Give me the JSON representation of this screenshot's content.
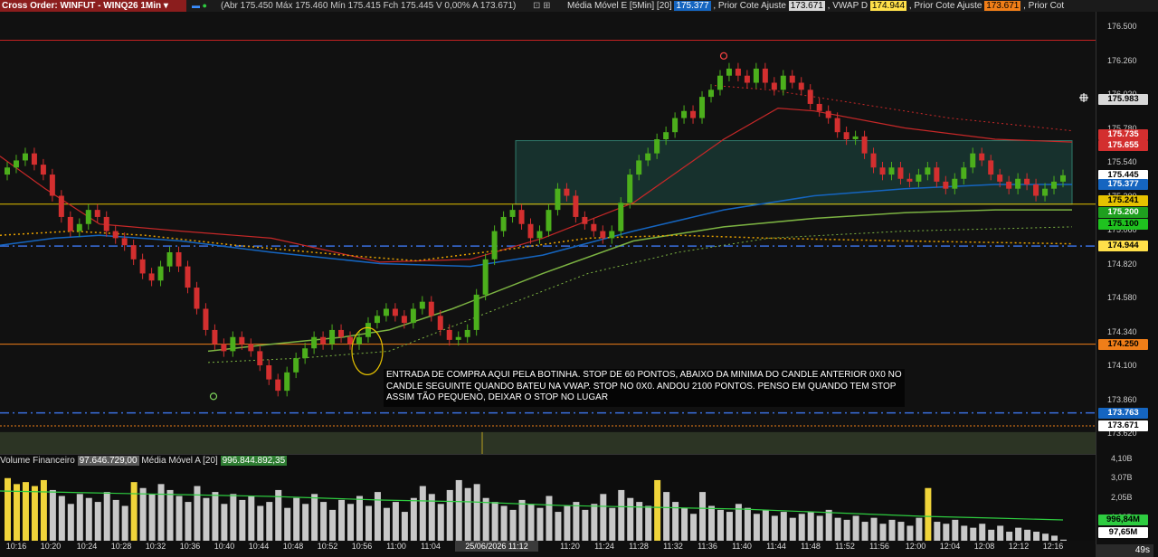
{
  "topbar": {
    "title": "Cross Order: WINFUT - WINQ26 1Min",
    "ohlc": "(Abr 175.450 Máx 175.460 Mín 175.415 Fch 175.445 V 0,00% A 173.671)",
    "ma_label": "Média Móvel E [5Min] [20]",
    "ma_value": "175.377",
    "prior1_label": ", Prior Cote Ajuste",
    "prior1_value": "173.671",
    "vwap_label": ", VWAP D",
    "vwap_value": "174.944",
    "prior2_label": ", Prior Cote Ajuste",
    "prior2_value": "173.671",
    "prior3_label": ", Prior Cot"
  },
  "annotation": "ENTRADA DE COMPRA AQUI PELA BOTINHA. STOP DE 60 PONTOS, ABAIXO DA MINIMA DO CANDLE ANTERIOR 0X0 NO CANDLE SEGUINTE QUANDO BATEU NA VWAP. STOP NO 0X0. ANDOU 2100 PONTOS. PENSO EM QUANDO TEM STOP ASSIM TÃO PEQUENO, DEIXAR O STOP NO LUGAR",
  "volume": {
    "label": "Volume Financeiro",
    "value": "97.646.729,00",
    "ma_label": "Média Móvel A [20]",
    "ma_value": "996.844.892,35",
    "ticks": [
      "4,10B",
      "3,07B",
      "2,05B",
      "1,02B"
    ],
    "ma_tag": "996,84M",
    "last_tag": "97,65M"
  },
  "price_axis_ticks": [
    "176.500",
    "176.260",
    "176.020",
    "175.780",
    "175.540",
    "175.300",
    "175.060",
    "174.820",
    "174.580",
    "174.340",
    "174.100",
    "173.860",
    "173.620"
  ],
  "price_tags": [
    {
      "value": "175.983",
      "bg": "#d8d8d8",
      "fg": "#000000"
    },
    {
      "value": "175.735",
      "bg": "#d32f2f",
      "fg": "#ffffff"
    },
    {
      "value": "175.655",
      "bg": "#d32f2f",
      "fg": "#ffffff"
    },
    {
      "value": "175.445",
      "bg": "#ffffff",
      "fg": "#000000"
    },
    {
      "value": "175.377",
      "bg": "#1565c0",
      "fg": "#ffffff"
    },
    {
      "value": "175.241",
      "bg": "#e6c200",
      "fg": "#000000"
    },
    {
      "value": "175.200",
      "bg": "#1fa01f",
      "fg": "#ffffff"
    },
    {
      "value": "175.100",
      "bg": "#1fc21f",
      "fg": "#000000"
    },
    {
      "value": "174.944",
      "bg": "#ffe04a",
      "fg": "#000000"
    },
    {
      "value": "174.250",
      "bg": "#f07e18",
      "fg": "#000000"
    },
    {
      "value": "173.763",
      "bg": "#1565c0",
      "fg": "#ffffff"
    },
    {
      "value": "173.671",
      "bg": "#ffffff",
      "fg": "#000000"
    }
  ],
  "time_ticks": [
    "10:16",
    "10:20",
    "10:24",
    "10:28",
    "10:32",
    "10:36",
    "10:40",
    "10:44",
    "10:48",
    "10:52",
    "10:56",
    "11:00",
    "11:04",
    "11:20",
    "11:24",
    "11:28",
    "11:32",
    "11:36",
    "11:40",
    "11:44",
    "11:48",
    "11:52",
    "11:56",
    "12:00",
    "12:04",
    "12:08",
    "12:12",
    "12:16"
  ],
  "time_highlight": "25/06/2026 11:12",
  "timer": "49s",
  "colors": {
    "up": "#4caf1c",
    "down": "#d32f2f",
    "vwap": "#1565c0",
    "ma_red": "#c62828",
    "ma_green": "#7cb342",
    "zone": "#1d4d45"
  },
  "candles_close": [
    175.5,
    175.55,
    175.6,
    175.52,
    175.45,
    175.3,
    175.15,
    175.05,
    175.1,
    175.2,
    175.15,
    175.05,
    175.0,
    174.95,
    174.85,
    174.75,
    174.7,
    174.8,
    174.9,
    174.8,
    174.65,
    174.5,
    174.35,
    174.25,
    174.2,
    174.3,
    174.25,
    174.2,
    174.1,
    174.0,
    173.92,
    174.05,
    174.15,
    174.22,
    174.3,
    174.25,
    174.35,
    174.3,
    174.25,
    174.3,
    174.4,
    174.45,
    174.5,
    174.45,
    174.4,
    174.5,
    174.55,
    174.45,
    174.35,
    174.28,
    174.3,
    174.35,
    174.6,
    174.85,
    175.05,
    175.15,
    175.2,
    175.1,
    175.0,
    175.05,
    175.2,
    175.35,
    175.3,
    175.15,
    175.1,
    175.05,
    175.0,
    175.05,
    175.25,
    175.45,
    175.55,
    175.6,
    175.7,
    175.75,
    175.85,
    175.9,
    175.85,
    176.0,
    176.05,
    176.15,
    176.2,
    176.15,
    176.1,
    176.2,
    176.1,
    176.05,
    176.15,
    176.1,
    176.05,
    175.95,
    175.9,
    175.85,
    175.75,
    175.7,
    175.72,
    175.6,
    175.5,
    175.45,
    175.5,
    175.42,
    175.4,
    175.45,
    175.5,
    175.4,
    175.35,
    175.42,
    175.5,
    175.6,
    175.55,
    175.45,
    175.4,
    175.35,
    175.42,
    175.38,
    175.3,
    175.35,
    175.4,
    175.445
  ],
  "volumes": [
    3.2,
    2.9,
    3.0,
    2.8,
    3.1,
    2.6,
    2.3,
    1.9,
    2.4,
    2.2,
    2.0,
    2.5,
    2.1,
    1.8,
    3.0,
    2.7,
    2.4,
    2.9,
    2.6,
    2.3,
    2.0,
    2.8,
    2.2,
    2.5,
    1.9,
    2.4,
    2.1,
    2.3,
    1.8,
    2.0,
    2.6,
    1.7,
    2.2,
    1.9,
    2.4,
    2.0,
    1.6,
    2.1,
    1.9,
    2.3,
    1.8,
    2.5,
    1.7,
    2.0,
    1.5,
    2.2,
    2.8,
    2.4,
    1.9,
    2.6,
    3.1,
    2.7,
    2.9,
    2.2,
    2.0,
    1.8,
    1.6,
    2.1,
    1.9,
    1.7,
    2.3,
    1.5,
    1.8,
    2.0,
    1.6,
    1.9,
    2.4,
    1.7,
    2.6,
    2.2,
    2.0,
    1.8,
    3.1,
    2.5,
    2.0,
    1.7,
    1.4,
    2.5,
    1.8,
    1.6,
    1.5,
    1.9,
    1.7,
    1.4,
    1.6,
    1.3,
    1.5,
    1.2,
    1.4,
    1.5,
    1.3,
    1.6,
    1.2,
    1.1,
    1.3,
    1.0,
    1.2,
    0.9,
    1.1,
    1.0,
    0.8,
    1.2,
    2.7,
    1.0,
    0.9,
    1.1,
    0.8,
    0.7,
    0.9,
    0.6,
    0.8,
    0.5,
    0.7,
    0.6,
    0.5,
    0.4,
    0.3,
    0.1
  ]
}
